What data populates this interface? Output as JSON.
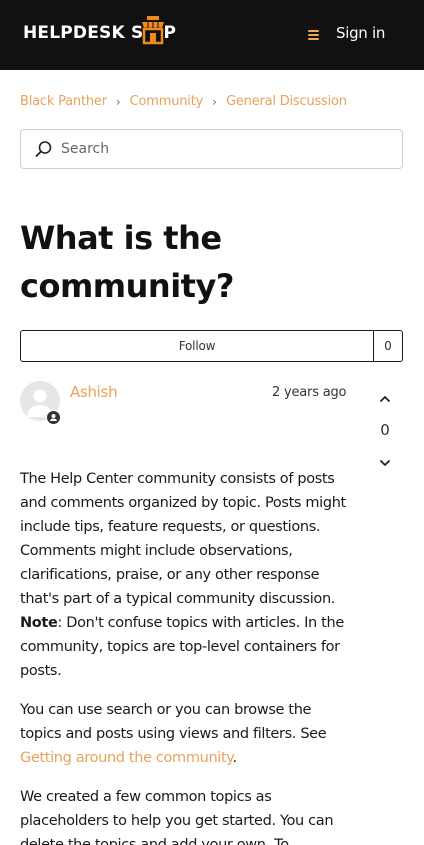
{
  "header": {
    "logo_left": "HELPDESK S",
    "logo_right": "P",
    "sign_in_label": "Sign in"
  },
  "breadcrumbs": [
    "Black Panther",
    "Community",
    "General Discussion"
  ],
  "search": {
    "placeholder": "Search",
    "value": ""
  },
  "post": {
    "title": "What is the community?",
    "follow_label": "Follow",
    "follow_count": "0",
    "author": "Ashish",
    "date": "2 years ago",
    "vote_count": "0",
    "p1_before_note": "The Help Center community consists of posts and comments organized by topic. Posts might include tips, feature requests, or questions. Comments might include observations, clarifications, praise, or any other response that's part of a typical community discussion. ",
    "p1_note": "Note",
    "p1_after_note": ": Don't confuse topics with articles. In the community, topics are top-level containers for posts.",
    "p2_before_link": "You can use search or you can browse the topics and posts using views and filters. See ",
    "p2_link": "Getting around the community",
    "p2_after_link": ".",
    "p3": "We created a few common topics as placeholders to help you get started. You can delete the topics and add your own. To"
  },
  "colors": {
    "accent": "#e8a25a",
    "header_bg": "#111111",
    "logo_orange": "#f08a1c"
  }
}
